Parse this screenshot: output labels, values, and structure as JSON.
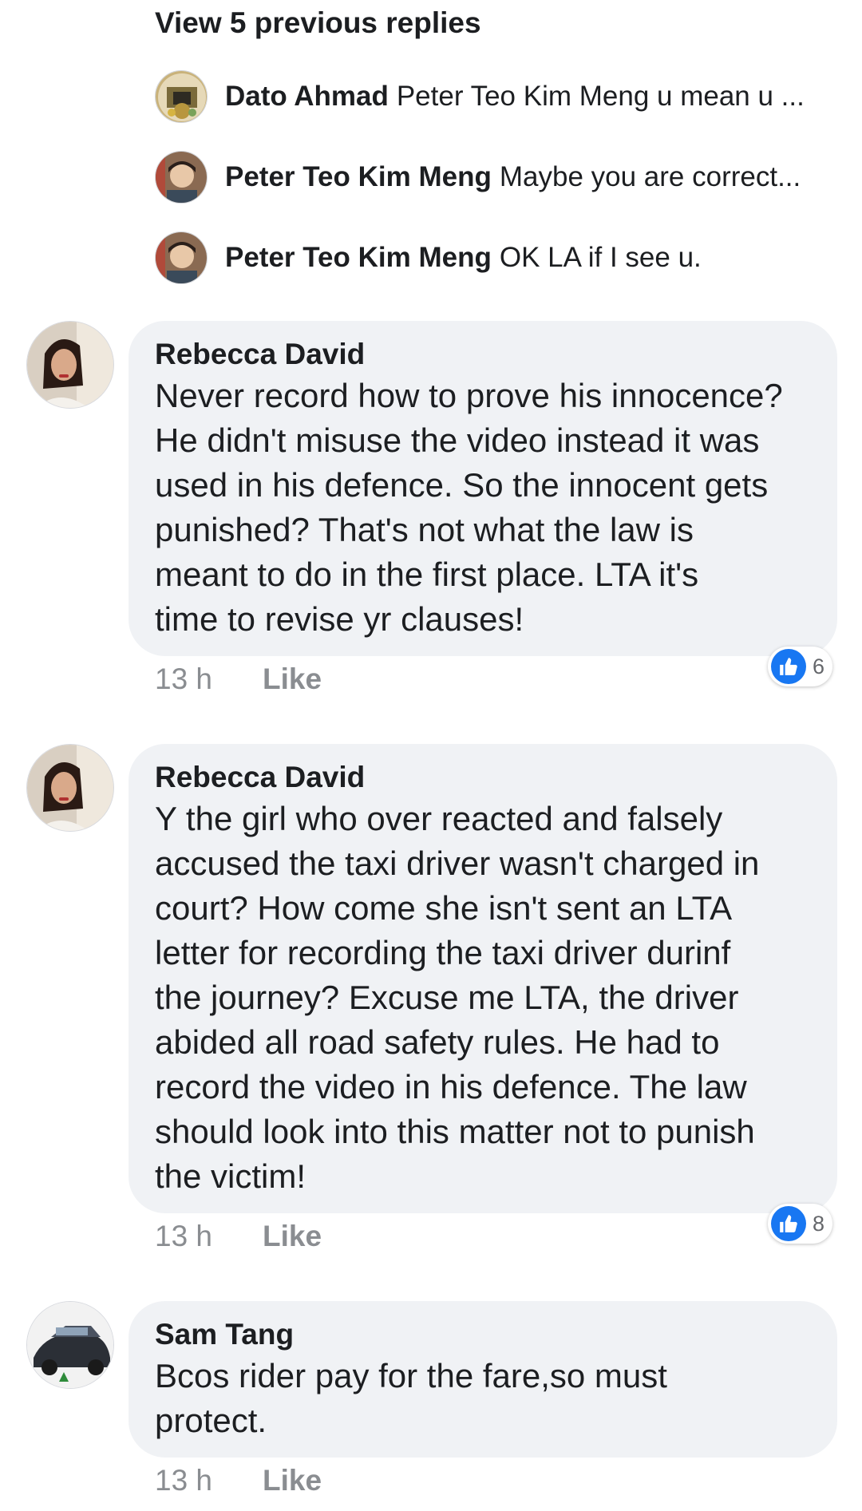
{
  "thread": {
    "view_previous_label": "View 5 previous replies"
  },
  "replies": [
    {
      "name": "Dato Ahmad",
      "text": "Peter Teo Kim Meng u mean u ..."
    },
    {
      "name": "Peter Teo Kim Meng",
      "text": "Maybe you are correct..."
    },
    {
      "name": "Peter Teo Kim Meng",
      "text": "OK LA if I see u."
    }
  ],
  "comments": [
    {
      "name": "Rebecca David",
      "lines": [
        "Never record how to prove his innocence?",
        "He didn't misuse the video instead it was",
        "used in his defence. So the innocent gets",
        "punished? That's not what the law is",
        "meant to do in the first place.  LTA it's",
        "time to revise yr clauses!"
      ],
      "time": "13 h",
      "like_label": "Like",
      "reaction_count": "6"
    },
    {
      "name": "Rebecca David",
      "lines": [
        "Y the girl who over reacted and falsely",
        "accused the taxi driver wasn't charged in",
        "court? How come she isn't sent an LTA",
        "letter for recording the taxi driver durinf",
        "the journey? Excuse me LTA, the driver",
        "abided all road safety rules. He had to",
        "record the video in his defence. The law",
        "should look into this matter not to punish",
        "the victim!"
      ],
      "time": "13 h",
      "like_label": "Like",
      "reaction_count": "8"
    },
    {
      "name": "Sam Tang",
      "lines": [
        "Bcos rider pay for the fare,so must",
        "protect."
      ],
      "time": "13 h",
      "like_label": "Like"
    }
  ],
  "colors": {
    "bubble": "#f0f2f5",
    "meta_text": "#8a8d91",
    "like_blue": "#1877f2"
  },
  "icons": [
    "profile-photo",
    "thumbs-up-reaction-icon"
  ]
}
